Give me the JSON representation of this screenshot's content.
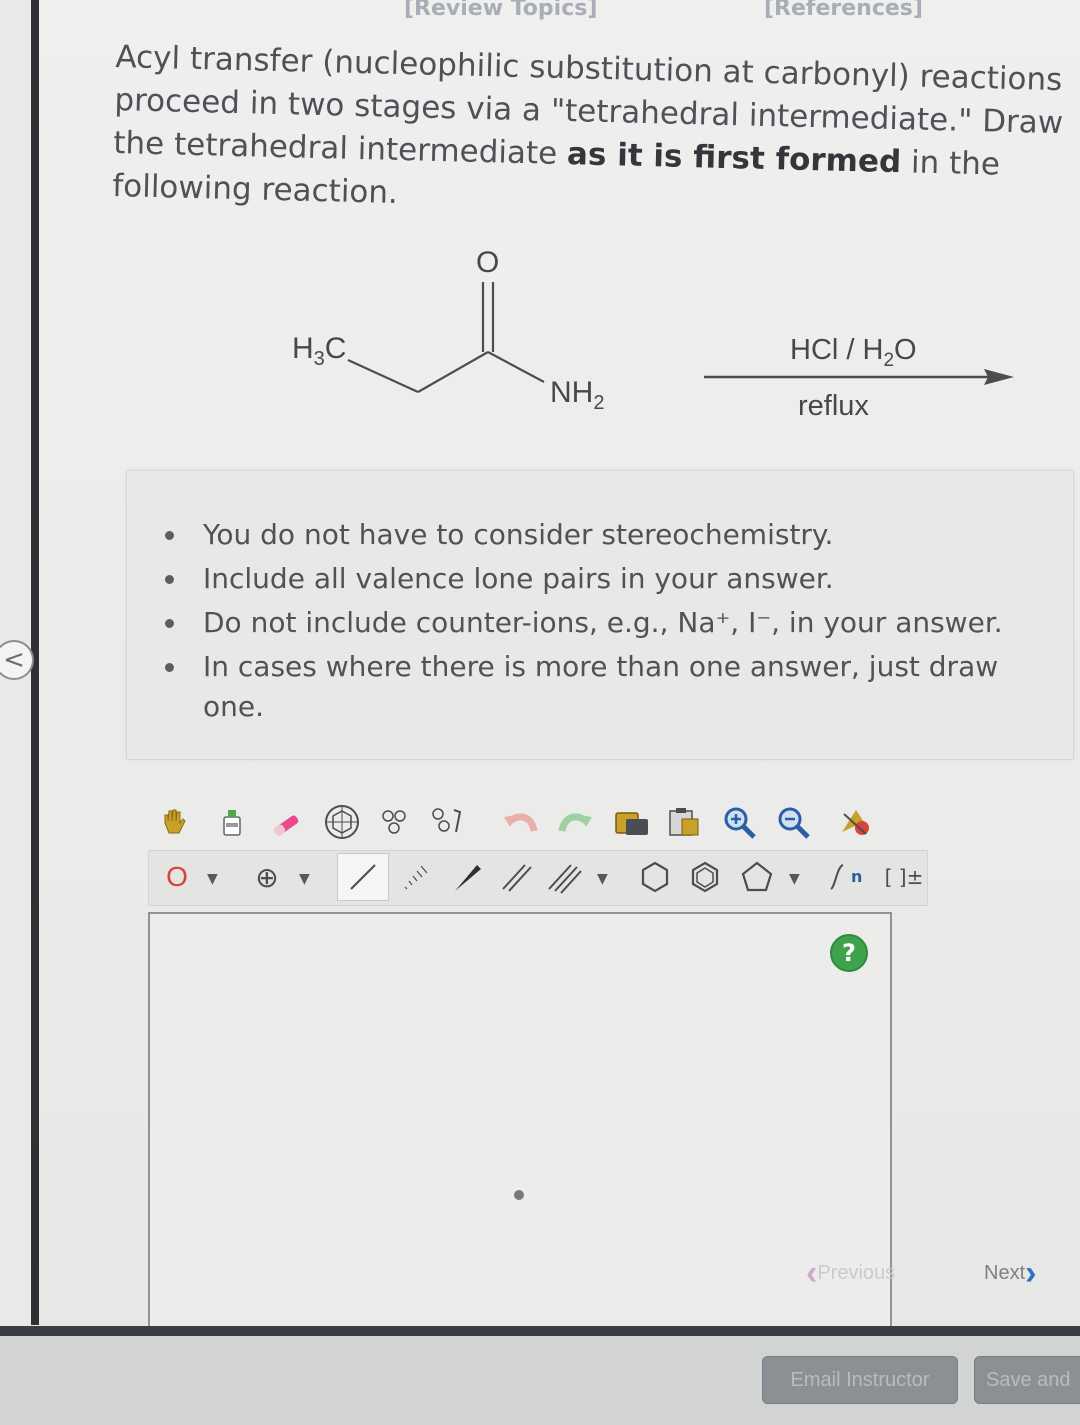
{
  "header": {
    "review_topics": "[Review Topics]",
    "references": "[References]"
  },
  "question": {
    "part1": "Acyl transfer (nucleophilic substitution at carbonyl) reactions proceed in two stages via a \"tetrahedral intermediate.\" Draw the tetrahedral intermediate ",
    "bold": "as it is first formed",
    "part2": " in the following reaction."
  },
  "reaction": {
    "atom_o": "O",
    "atom_h3c_main": "H",
    "atom_h3c_sub": "3",
    "atom_h3c_end": "C",
    "atom_nh2_main": "NH",
    "atom_nh2_sub": "2",
    "reagent_a": "HCl / H",
    "reagent_sub": "2",
    "reagent_b": "O",
    "condition": "reflux"
  },
  "instructions": [
    "You do not have to consider stereochemistry.",
    "Include all valence lone pairs in your answer.",
    "Do not include counter-ions, e.g., Na⁺, I⁻, in your answer.",
    "In cases where there is more than one answer, just draw one."
  ],
  "toolbar": {
    "atom_select": "O",
    "charge_symbol": "⊕",
    "bracket_label": "[ ]±",
    "sn_label": "n"
  },
  "canvas": {
    "help": "?"
  },
  "navigation": {
    "previous": "Previous",
    "next": "Next"
  },
  "footer": {
    "email_instructor": "Email Instructor",
    "save_and_exit": "Save and"
  },
  "sidebar": {
    "toggle": "<"
  },
  "colors": {
    "help_green": "#3fa34d",
    "next_blue": "#2a71c9",
    "atom_red": "#d9443a",
    "tool_green": "#4aa84a",
    "tool_gold": "#c8a02a"
  }
}
